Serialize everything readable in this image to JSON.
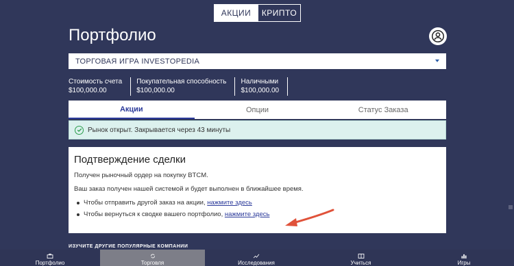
{
  "toggle": {
    "stocks": "АКЦИИ",
    "crypto": "КРИПТО"
  },
  "page": {
    "title": "Портфолио"
  },
  "game_select": {
    "value": "ТОРГОВАЯ ИГРА INVESTOPEDIA"
  },
  "stats": [
    {
      "label": "Стоимость счета",
      "value": "$100,000.00"
    },
    {
      "label": "Покупательная способность",
      "value": "$100,000.00"
    },
    {
      "label": "Наличными",
      "value": "$100,000.00"
    }
  ],
  "tabs": [
    {
      "label": "Акции"
    },
    {
      "label": "Опции"
    },
    {
      "label": "Статус Заказа"
    }
  ],
  "alert": {
    "text": "Рынок открыт. Закрывается через 43 минуты"
  },
  "confirmation": {
    "title": "Подтверждение сделки",
    "line1": "Получен рыночный ордер на покупку BTCM.",
    "line2": "Ваш заказ получен нашей системой и будет выполнен в ближайшее время.",
    "bullet1_text": "Чтобы отправить другой заказ на акции, ",
    "bullet1_link": "нажмите здесь",
    "bullet2_text": "Чтобы вернуться к сводке вашего портфолио, ",
    "bullet2_link": "нажмите здесь"
  },
  "popular": {
    "title": "ИЗУЧИТЕ ДРУГИЕ ПОПУЛЯРНЫЕ КОМПАНИИ"
  },
  "nav": [
    {
      "label": "Портфолио",
      "icon": "briefcase-icon"
    },
    {
      "label": "Торговля",
      "icon": "refresh-icon"
    },
    {
      "label": "Исследования",
      "icon": "chart-line-icon"
    },
    {
      "label": "Учиться",
      "icon": "book-icon"
    },
    {
      "label": "Игры",
      "icon": "bar-chart-icon"
    }
  ],
  "colors": {
    "background": "#30375a",
    "accent": "#2b3a9a",
    "alert_bg": "#dcf1ee",
    "arrow": "#e0523a"
  }
}
